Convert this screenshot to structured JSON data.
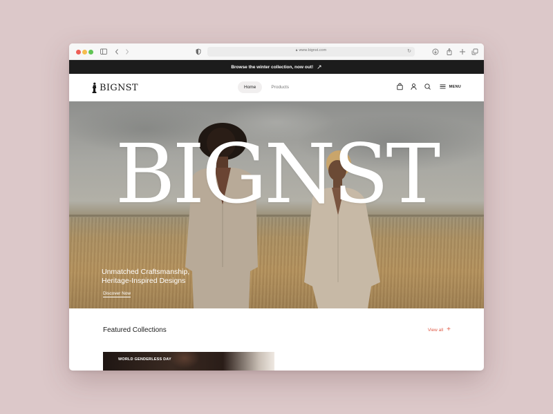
{
  "browser": {
    "url": "www.bignst.com"
  },
  "announcement": {
    "text": "Browse the winter collection, now out!",
    "arrow": "↗"
  },
  "header": {
    "logo_text": "BIGNST",
    "nav": [
      {
        "label": "Home",
        "active": true
      },
      {
        "label": "Products",
        "active": false
      }
    ],
    "icons": [
      "bag-icon",
      "user-icon",
      "search-icon",
      "menu-icon"
    ],
    "menu_label": "MENU"
  },
  "hero": {
    "wordmark": "BIGNST",
    "tagline_line1": "Unmatched Craftsmanship,",
    "tagline_line2": "Heritage-Inspired Designs",
    "cta": "Discover Now"
  },
  "featured": {
    "title": "Featured Collections",
    "view_all": "View all",
    "plus": "+",
    "cards": [
      {
        "label": "WORLD GENDERLESS DAY"
      }
    ]
  },
  "colors": {
    "background": "#dcc8c9",
    "announcement_bg": "#1c1c1c",
    "accent": "#e05a46"
  }
}
